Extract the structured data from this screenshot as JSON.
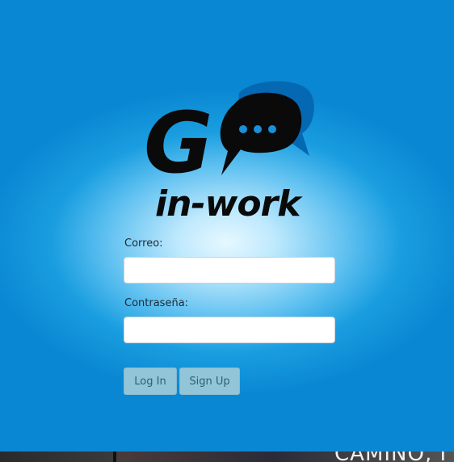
{
  "logo": {
    "letter": "G",
    "tagline": "in-work",
    "icon": "speech-bubble-icon"
  },
  "form": {
    "email_label": "Correo:",
    "email_value": "",
    "password_label": "Contraseña:",
    "password_value": "",
    "login_label": "Log In",
    "signup_label": "Sign Up"
  },
  "background": {
    "caption": "CAMINO, I"
  },
  "colors": {
    "panel_blue": "#0a87d2",
    "button_fill": "#93c5d9",
    "logo_black": "#0a0a0a"
  }
}
